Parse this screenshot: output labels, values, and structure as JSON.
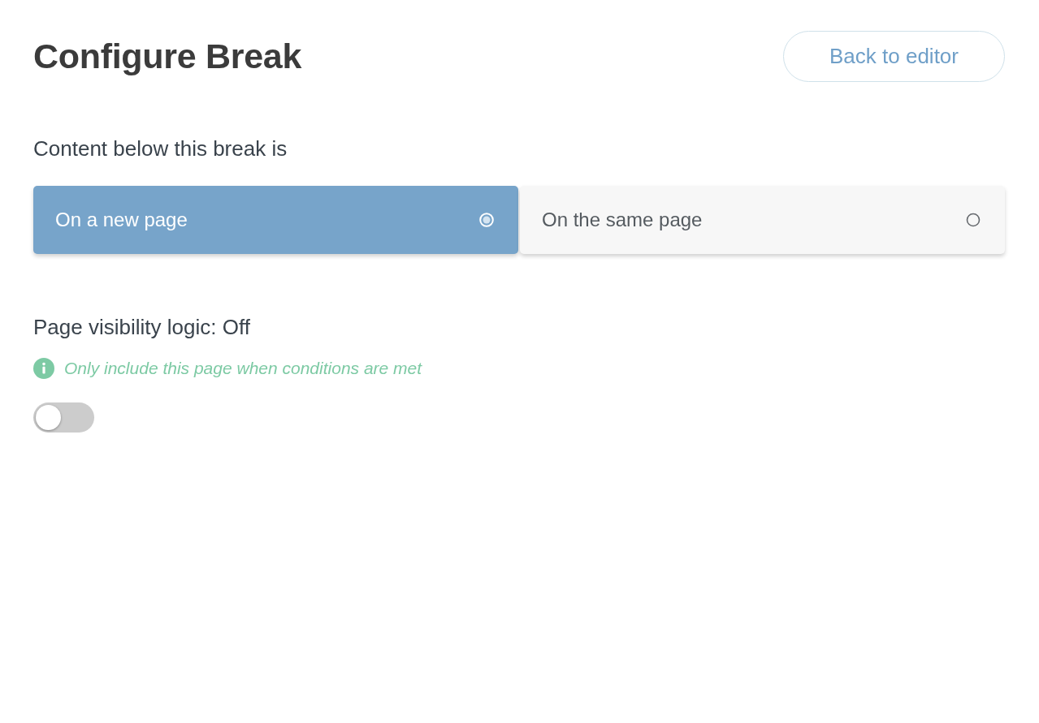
{
  "header": {
    "title": "Configure Break",
    "back_button": "Back to editor"
  },
  "break_placement": {
    "label": "Content below this break is",
    "options": [
      {
        "label": "On a new page",
        "selected": true
      },
      {
        "label": "On the same page",
        "selected": false
      }
    ]
  },
  "visibility_logic": {
    "label": "Page visibility logic: Off",
    "hint": "Only include this page when conditions are met",
    "toggle": {
      "on": false
    }
  }
}
